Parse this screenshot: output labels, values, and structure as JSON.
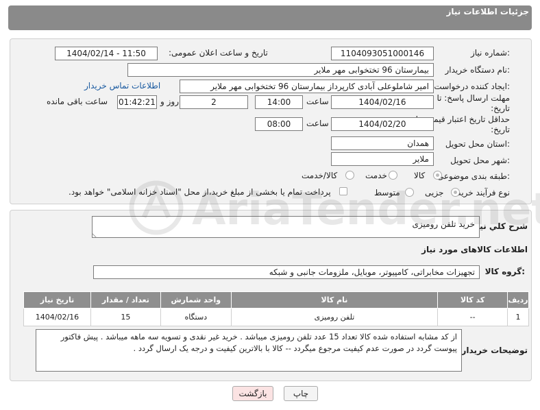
{
  "header": {
    "title": "جزئیات اطلاعات نیاز"
  },
  "fields": {
    "need_number_label": "شماره نیاز:",
    "need_number": "1104093051000146",
    "announce_label": "تاریخ و ساعت اعلان عمومی:",
    "announce_value": "1404/02/14 - 11:50",
    "buyer_org_label": "نام دستگاه خریدار:",
    "buyer_org": "بیمارستان 96 تختخوابی مهر ملایر",
    "creator_label": "ایجاد کننده درخواست:",
    "creator": "امیر شاملوعلی آبادی کارپرداز بیمارستان 96 تختخوابی مهر ملایر",
    "buyer_contact_link": "اطلاعات تماس خریدار",
    "deadline_label": "مهلت ارسال پاسخ: تا تاریخ:",
    "deadline_date": "1404/02/16",
    "time_label": "ساعت",
    "deadline_time": "14:00",
    "days_value": "2",
    "days_label": "روز و",
    "remaining_time": "01:42:21",
    "remaining_label": "ساعت باقی مانده",
    "price_validity_label": "حداقل تاریخ اعتبار قیمت: تا تاریخ:",
    "price_validity_date": "1404/02/20",
    "price_validity_time": "08:00",
    "province_label": "استان محل تحویل:",
    "province": "همدان",
    "city_label": "شهر محل تحویل:",
    "city": "ملایر",
    "category_label": "طبقه بندی موضوعی:",
    "category_options": [
      "کالا",
      "خدمت",
      "کالا/خدمت"
    ],
    "process_label": "نوع فرآیند خرید :",
    "process_options": [
      "جزیی",
      "متوسط"
    ],
    "payment_note": "پرداخت تمام یا بخشی از مبلغ خرید،از محل \"اسناد خزانه اسلامی\" خواهد بود."
  },
  "details": {
    "desc_label": "شرح کلي نياز:",
    "desc_value": "خرید تلفن رومیزی",
    "goods_info_title": "اطلاعات کالاهای مورد نیاز",
    "group_label": "گروه کالا:",
    "group_value": "تجهیزات مخابراتی، کامپیوتر، موبایل، ملزومات جانبی و شبکه"
  },
  "table": {
    "headers": [
      "ردیف",
      "کد کالا",
      "نام کالا",
      "واحد شمارش",
      "تعداد / مقدار",
      "تاریخ نیاز"
    ],
    "rows": [
      [
        "1",
        "--",
        "تلفن رومیزی",
        "دستگاه",
        "15",
        "1404/02/16"
      ]
    ]
  },
  "notes": {
    "label": "توضیحات خریدار:",
    "text": "از کد مشابه استفاده شده کالا تعداد 15 عدد  تلفن رومیزی  میباشد . خرید غیر نقدی و تسویه سه ماهه میباشد . پیش فاکتور پیوست گردد  در صورت عدم کیفیت مرجوع میگردد --  کالا با بالاترین کیفیت  و درجه یک ارسال گردد ."
  },
  "buttons": {
    "print": "چاپ",
    "back": "بازگشت"
  },
  "watermark": "AriaTender.net",
  "colors": {
    "header": "#8a8a8a",
    "back_button": "#fbe3e3",
    "link": "#1a5aa0"
  }
}
